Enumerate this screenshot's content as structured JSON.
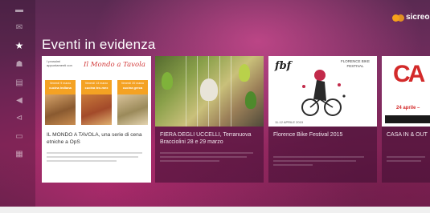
{
  "header": {
    "section_title": "Eventi in evidenza",
    "brand_name": "sicreo"
  },
  "sidebar": {
    "items": [
      {
        "icon": "chat-icon",
        "active": false
      },
      {
        "icon": "mail-icon",
        "active": false
      },
      {
        "icon": "star-icon",
        "active": true
      },
      {
        "icon": "people-icon",
        "active": false
      },
      {
        "icon": "document-icon",
        "active": false
      },
      {
        "icon": "megaphone-icon",
        "active": false
      },
      {
        "icon": "share-icon",
        "active": false
      },
      {
        "icon": "card-icon",
        "active": false
      },
      {
        "icon": "calendar-icon",
        "active": false
      }
    ]
  },
  "events": [
    {
      "title": "IL MONDO A TAVOLA, una serie di cena etniche a OpS",
      "thumb": {
        "heading": "I prossimi appuntamenti con",
        "brand": "Il Mondo a Tavola",
        "dishes": [
          {
            "date": "Venerdì 9 marzo",
            "cuisine": "cucina indiana"
          },
          {
            "date": "Venerdì 13 marzo",
            "cuisine": "cucina tex-mex"
          },
          {
            "date": "Venerdì 20 marzo",
            "cuisine": "cucina greca"
          }
        ]
      }
    },
    {
      "title": "FIERA DEGLI UCCELLI, Terranuova Bracciolini 28 e 29 marzo"
    },
    {
      "title": "Florence Bike Festival 2015",
      "thumb": {
        "logo": "fbf",
        "subtitle": "FLORENCE BIKE FESTIVAL",
        "date": "11-12 APRILE 2015"
      }
    },
    {
      "title": "CASA IN & OUT",
      "thumb": {
        "logo": "CA",
        "date": "24 aprile –"
      }
    }
  ],
  "colors": {
    "background": "#7c2e63",
    "brand_accent": "#f7a21b",
    "dish_label": "#f4a223"
  }
}
